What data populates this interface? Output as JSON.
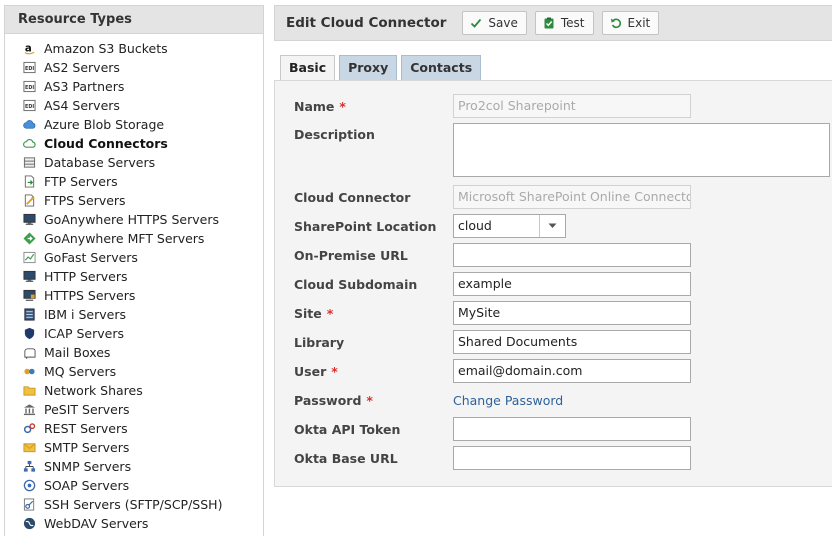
{
  "sidebar": {
    "title": "Resource Types",
    "items": [
      {
        "label": "Amazon S3 Buckets",
        "icon": "amazon-icon"
      },
      {
        "label": "AS2 Servers",
        "icon": "edi-icon"
      },
      {
        "label": "AS3 Partners",
        "icon": "edi-icon"
      },
      {
        "label": "AS4 Servers",
        "icon": "edi-icon"
      },
      {
        "label": "Azure Blob Storage",
        "icon": "azure-cloud-icon"
      },
      {
        "label": "Cloud Connectors",
        "icon": "cloud-icon",
        "active": true
      },
      {
        "label": "Database Servers",
        "icon": "database-icon"
      },
      {
        "label": "FTP Servers",
        "icon": "ftp-file-icon"
      },
      {
        "label": "FTPS Servers",
        "icon": "ftps-file-icon"
      },
      {
        "label": "GoAnywhere HTTPS Servers",
        "icon": "monitor-icon"
      },
      {
        "label": "GoAnywhere MFT Servers",
        "icon": "goanywhere-icon"
      },
      {
        "label": "GoFast Servers",
        "icon": "chart-icon"
      },
      {
        "label": "HTTP Servers",
        "icon": "monitor-icon"
      },
      {
        "label": "HTTPS Servers",
        "icon": "secure-monitor-icon"
      },
      {
        "label": "IBM i Servers",
        "icon": "server-icon"
      },
      {
        "label": "ICAP Servers",
        "icon": "shield-icon"
      },
      {
        "label": "Mail Boxes",
        "icon": "mailbox-icon"
      },
      {
        "label": "MQ Servers",
        "icon": "mq-icon"
      },
      {
        "label": "Network Shares",
        "icon": "folder-icon"
      },
      {
        "label": "PeSIT Servers",
        "icon": "bank-icon"
      },
      {
        "label": "REST Servers",
        "icon": "gears-icon"
      },
      {
        "label": "SMTP Servers",
        "icon": "envelope-icon"
      },
      {
        "label": "SNMP Servers",
        "icon": "network-icon"
      },
      {
        "label": "SOAP Servers",
        "icon": "soap-icon"
      },
      {
        "label": "SSH Servers (SFTP/SCP/SSH)",
        "icon": "ssh-key-icon"
      },
      {
        "label": "WebDAV Servers",
        "icon": "globe-icon"
      }
    ]
  },
  "toolbar": {
    "title": "Edit Cloud Connector",
    "save_label": "Save",
    "test_label": "Test",
    "exit_label": "Exit"
  },
  "tabs": [
    {
      "label": "Basic",
      "active": true
    },
    {
      "label": "Proxy"
    },
    {
      "label": "Contacts"
    }
  ],
  "form": {
    "name_label": "Name",
    "name_value": "Pro2col Sharepoint",
    "description_label": "Description",
    "description_value": "",
    "connector_label": "Cloud Connector",
    "connector_value": "Microsoft SharePoint Online Connector",
    "location_label": "SharePoint Location",
    "location_value": "cloud",
    "onprem_label": "On-Premise URL",
    "onprem_value": "",
    "subdomain_label": "Cloud Subdomain",
    "subdomain_value": "example",
    "site_label": "Site",
    "site_value": "MySite",
    "library_label": "Library",
    "library_value": "Shared Documents",
    "user_label": "User",
    "user_value": "email@domain.com",
    "password_label": "Password",
    "password_link": "Change Password",
    "okta_token_label": "Okta API Token",
    "okta_token_value": "",
    "okta_url_label": "Okta Base URL",
    "okta_url_value": "",
    "required_mark": "*"
  },
  "colors": {
    "accent_link": "#2e6299",
    "required": "#d9302c",
    "tab_inactive": "#c9d6e3"
  }
}
